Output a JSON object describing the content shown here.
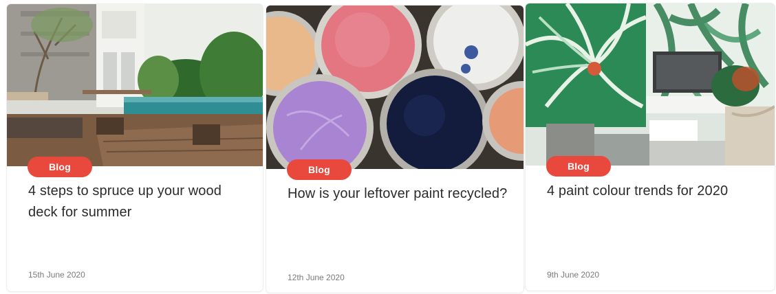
{
  "colors": {
    "badge": "#e8493c",
    "title": "#2b2b2b",
    "date": "#7a7a7a",
    "card_background": "#ffffff"
  },
  "cards": [
    {
      "badge": "Blog",
      "title": "4 steps to spruce up your wood deck for summer",
      "date": "15th June 2020",
      "image": "wood-deck-pool-photo"
    },
    {
      "badge": "Blog",
      "title": "How is your leftover paint recycled?",
      "date": "12th June 2020",
      "image": "paint-cans-photo"
    },
    {
      "badge": "Blog",
      "title": "4 paint colour trends for 2020",
      "date": "9th June 2020",
      "image": "tropical-wallpaper-living-room-photo"
    }
  ]
}
